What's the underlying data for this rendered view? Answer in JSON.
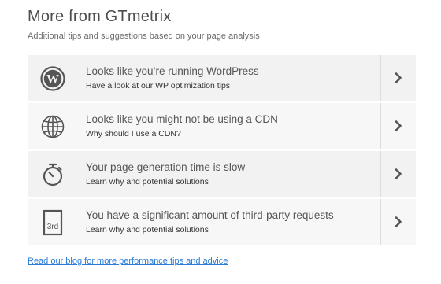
{
  "header": {
    "title": "More from GTmetrix",
    "subtitle": "Additional tips and suggestions based on your page analysis"
  },
  "tips": [
    {
      "icon": "wordpress-icon",
      "heading": "Looks like you’re running WordPress",
      "sub": "Have a look at our WP optimization tips"
    },
    {
      "icon": "globe-icon",
      "heading": "Looks like you might not be using a CDN",
      "sub": "Why should I use a CDN?"
    },
    {
      "icon": "stopwatch-icon",
      "heading": "Your page generation time is slow",
      "sub": "Learn why and potential solutions"
    },
    {
      "icon": "third-party-icon",
      "icon_text": "3rd",
      "heading": "You have a significant amount of third-party requests",
      "sub": "Learn why and potential solutions"
    }
  ],
  "footer": {
    "link_text": "Read our blog for more performance tips and advice"
  }
}
